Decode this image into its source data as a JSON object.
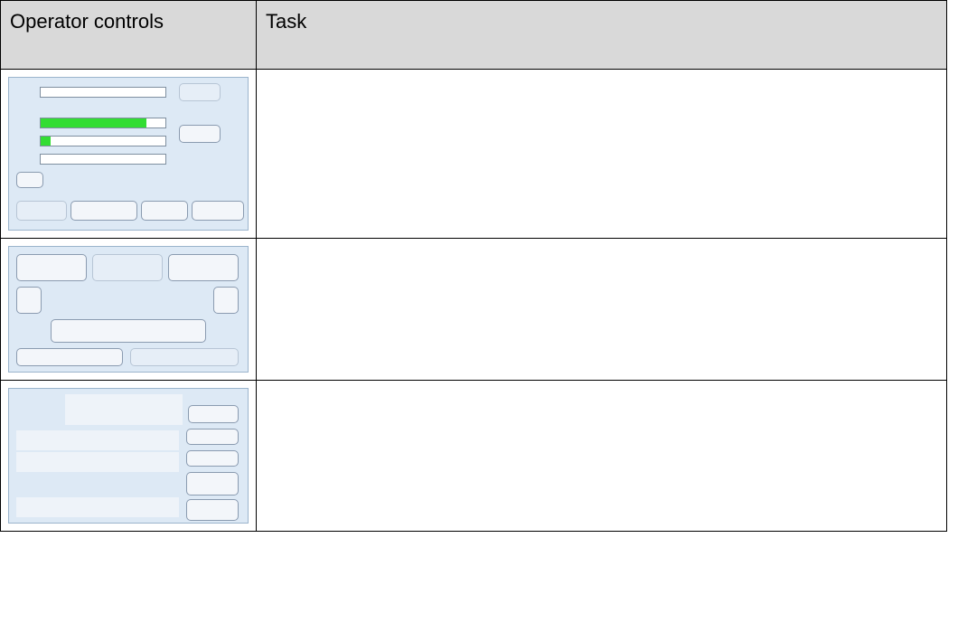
{
  "table": {
    "header_left": "Operator controls",
    "header_right": "Task"
  },
  "rows": [
    {
      "task": ""
    },
    {
      "task": ""
    },
    {
      "task": ""
    }
  ],
  "panels": {
    "sensitivity": {
      "gain_level": 0.85,
      "sea_level": 0.08,
      "rain_level": 0.0
    }
  },
  "colors": {
    "header_bg": "#d9d9d9",
    "panel_bg": "#dde9f5",
    "slider_fill": "#33dd33"
  }
}
